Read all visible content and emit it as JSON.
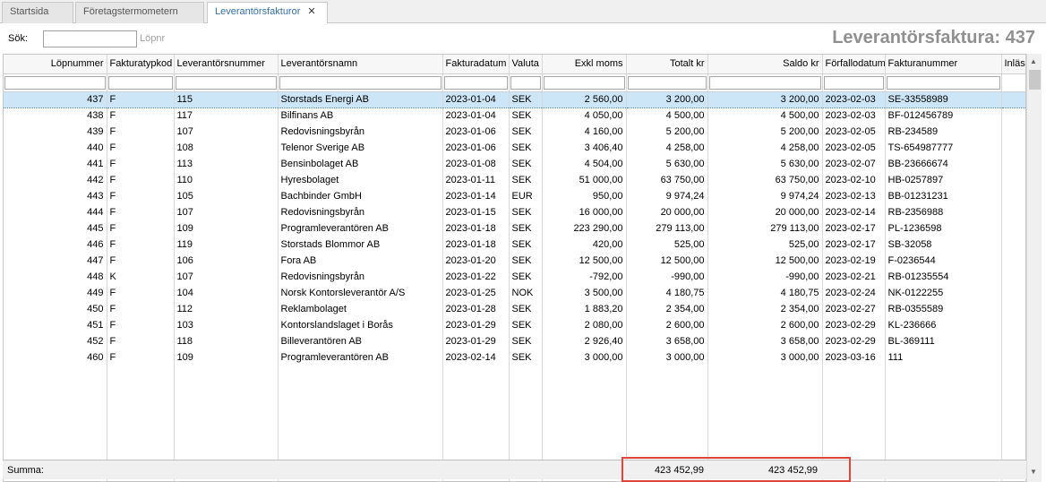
{
  "tabs": [
    {
      "label": "Startsida",
      "active": false
    },
    {
      "label": "Företagstermometern",
      "active": false
    },
    {
      "label": "Leverantörsfakturor",
      "active": true
    }
  ],
  "search": {
    "label": "Sök:",
    "value": "",
    "hint": "Löpnr"
  },
  "page_title": "Leverantörsfaktura: 437",
  "columns": [
    "Löpnummer",
    "Fakturatypkod",
    "Leverantörsnummer",
    "Leverantörsnamn",
    "Fakturadatum",
    "Valuta",
    "Exkl moms",
    "Totalt kr",
    "Saldo kr",
    "Förfallodatum",
    "Fakturanummer",
    "Inläs"
  ],
  "rows": [
    [
      "437",
      "F",
      "115",
      "Storstads Energi AB",
      "2023-01-04",
      "SEK",
      "2 560,00",
      "3 200,00",
      "3 200,00",
      "2023-02-03",
      "SE-33558989"
    ],
    [
      "438",
      "F",
      "117",
      "Bilfinans AB",
      "2023-01-04",
      "SEK",
      "4 050,00",
      "4 500,00",
      "4 500,00",
      "2023-02-03",
      "BF-012456789"
    ],
    [
      "439",
      "F",
      "107",
      "Redovisningsbyrån",
      "2023-01-06",
      "SEK",
      "4 160,00",
      "5 200,00",
      "5 200,00",
      "2023-02-05",
      "RB-234589"
    ],
    [
      "440",
      "F",
      "108",
      "Telenor Sverige AB",
      "2023-01-06",
      "SEK",
      "3 406,40",
      "4 258,00",
      "4 258,00",
      "2023-02-05",
      "TS-654987777"
    ],
    [
      "441",
      "F",
      "113",
      "Bensinbolaget AB",
      "2023-01-08",
      "SEK",
      "4 504,00",
      "5 630,00",
      "5 630,00",
      "2023-02-07",
      "BB-23666674"
    ],
    [
      "442",
      "F",
      "110",
      "Hyresbolaget",
      "2023-01-11",
      "SEK",
      "51 000,00",
      "63 750,00",
      "63 750,00",
      "2023-02-10",
      "HB-0257897"
    ],
    [
      "443",
      "F",
      "105",
      "Bachbinder GmbH",
      "2023-01-14",
      "EUR",
      "950,00",
      "9 974,24",
      "9 974,24",
      "2023-02-13",
      "BB-01231231"
    ],
    [
      "444",
      "F",
      "107",
      "Redovisningsbyrån",
      "2023-01-15",
      "SEK",
      "16 000,00",
      "20 000,00",
      "20 000,00",
      "2023-02-14",
      "RB-2356988"
    ],
    [
      "445",
      "F",
      "109",
      "Programleverantören AB",
      "2023-01-18",
      "SEK",
      "223 290,00",
      "279 113,00",
      "279 113,00",
      "2023-02-17",
      "PL-1236598"
    ],
    [
      "446",
      "F",
      "119",
      "Storstads Blommor AB",
      "2023-01-18",
      "SEK",
      "420,00",
      "525,00",
      "525,00",
      "2023-02-17",
      "SB-32058"
    ],
    [
      "447",
      "F",
      "106",
      "Fora AB",
      "2023-01-20",
      "SEK",
      "12 500,00",
      "12 500,00",
      "12 500,00",
      "2023-02-19",
      "F-0236544"
    ],
    [
      "448",
      "K",
      "107",
      "Redovisningsbyrån",
      "2023-01-22",
      "SEK",
      "-792,00",
      "-990,00",
      "-990,00",
      "2023-02-21",
      "RB-01235554"
    ],
    [
      "449",
      "F",
      "104",
      "Norsk Kontorsleverantör A/S",
      "2023-01-25",
      "NOK",
      "3 500,00",
      "4 180,75",
      "4 180,75",
      "2023-02-24",
      "NK-0122255"
    ],
    [
      "450",
      "F",
      "112",
      "Reklambolaget",
      "2023-01-28",
      "SEK",
      "1 883,20",
      "2 354,00",
      "2 354,00",
      "2023-02-27",
      "RB-0355589"
    ],
    [
      "451",
      "F",
      "103",
      "Kontorslandslaget i Borås",
      "2023-01-29",
      "SEK",
      "2 080,00",
      "2 600,00",
      "2 600,00",
      "2023-02-29",
      "KL-236666"
    ],
    [
      "452",
      "F",
      "118",
      "Billeverantören AB",
      "2023-01-29",
      "SEK",
      "2 926,40",
      "3 658,00",
      "3 658,00",
      "2023-02-29",
      "BL-369111"
    ],
    [
      "460",
      "F",
      "109",
      "Programleverantören AB",
      "2023-02-14",
      "SEK",
      "3 000,00",
      "3 000,00",
      "3 000,00",
      "2023-03-16",
      "111"
    ]
  ],
  "summary": {
    "label": "Summa:",
    "totalt": "423 452,99",
    "saldo": "423 452,99"
  },
  "colors": {
    "highlight": "#e0453a",
    "selected_row": "#cde6f7",
    "active_tab_text": "#3070b0"
  }
}
